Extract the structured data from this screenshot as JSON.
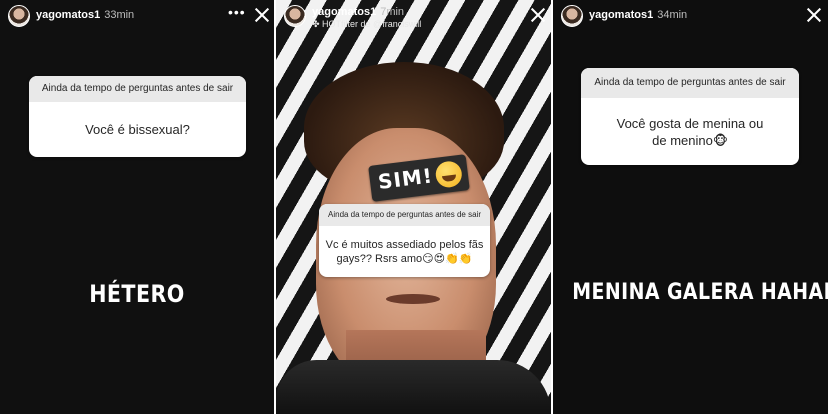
{
  "stories": [
    {
      "user": "yagomatos1",
      "time": "33min",
      "question_header": "Ainda da tempo de perguntas antes de sair",
      "question": "Você é bissexual?",
      "answer": "HÉTERO"
    },
    {
      "user": "yagomatos1",
      "time": "7min",
      "filter": "HOTfilter de @franciswill",
      "sticker_text": "SIM!",
      "question_header": "Ainda da tempo de perguntas antes de sair",
      "question": "Vc é muitos assediado pelos fãs gays?? Rsrs amo😏😍👏👏"
    },
    {
      "user": "yagomatos1",
      "time": "34min",
      "question_header": "Ainda da tempo de perguntas antes de sair",
      "question": "Você gosta de menina ou de menino🐵",
      "answer": "MENINA GALERA HAHAHA"
    }
  ],
  "icons": {
    "avatar": "avatar",
    "more": "more-options-icon",
    "close": "close-icon",
    "filter": "filter-icon",
    "sticker_emoji": "grinning-sweat-emoji"
  },
  "colors": {
    "story_bg": "#101010",
    "card_header_bg": "#e9e9e9",
    "card_bg": "#ffffff",
    "text_dark": "#262626",
    "text_light": "#ffffff"
  }
}
